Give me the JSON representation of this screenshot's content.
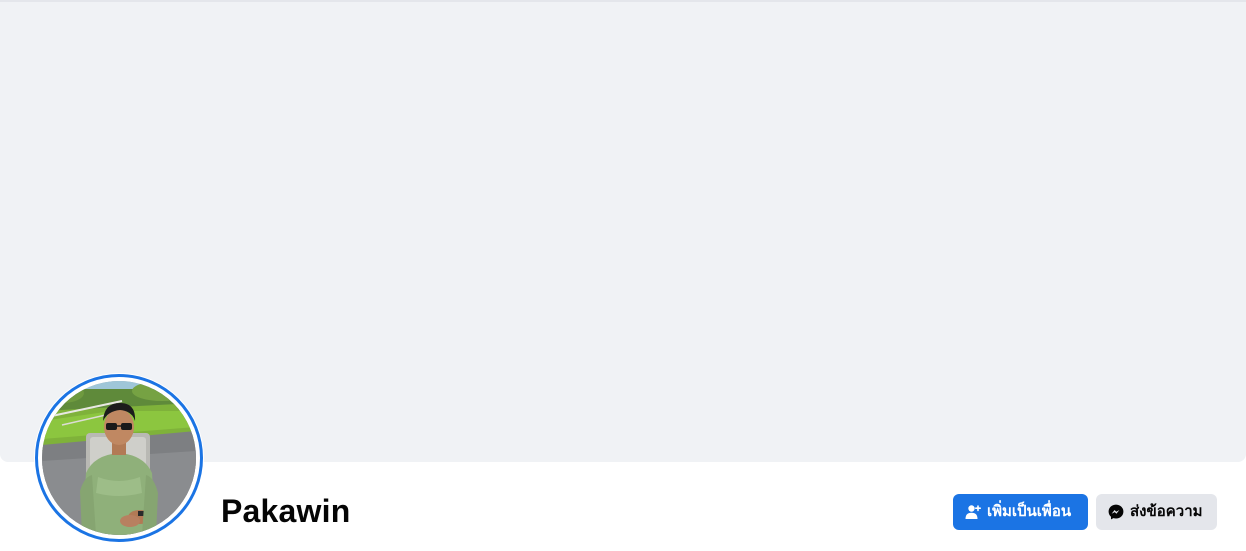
{
  "profile": {
    "name": "Pakawin",
    "avatar_description": "profile-photo"
  },
  "actions": {
    "add_friend": {
      "label": "เพิ่มเป็นเพื่อน",
      "icon": "add-friend-icon"
    },
    "message": {
      "label": "ส่งข้อความ",
      "icon": "messenger-icon"
    }
  },
  "colors": {
    "accent": "#1b74e4",
    "cover": "#f0f2f5",
    "secondary_button": "#e4e6eb",
    "text": "#050505"
  }
}
